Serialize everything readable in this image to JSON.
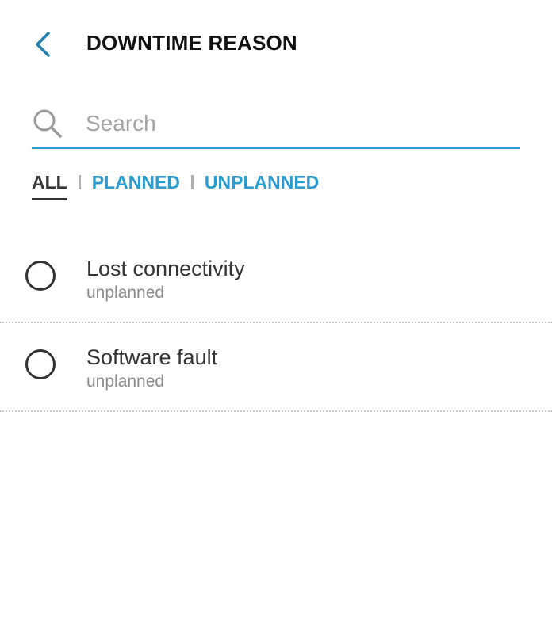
{
  "header": {
    "back_icon": "chevron-left-icon",
    "title": "DOWNTIME REASON"
  },
  "search": {
    "icon": "search-icon",
    "placeholder": "Search",
    "value": "",
    "accent_color": "#2a9bd0"
  },
  "filters": {
    "active": "ALL",
    "items": [
      {
        "label": "ALL"
      },
      {
        "label": "PLANNED"
      },
      {
        "label": "UNPLANNED"
      }
    ]
  },
  "reasons": [
    {
      "title": "Lost connectivity",
      "type": "unplanned",
      "selected": false
    },
    {
      "title": "Software fault",
      "type": "unplanned",
      "selected": false
    }
  ]
}
